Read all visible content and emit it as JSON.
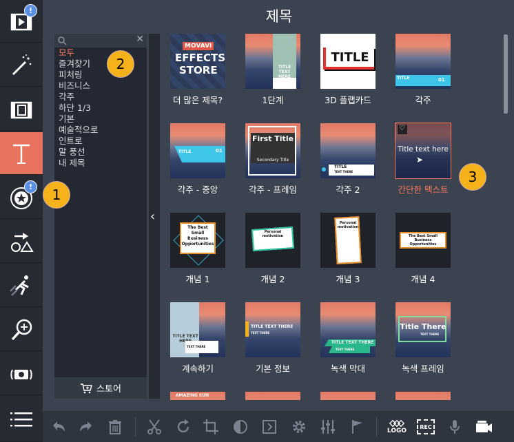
{
  "title": "제목",
  "sidebar": {
    "tools": [
      {
        "name": "media-import-icon",
        "badge": "!"
      },
      {
        "name": "magic-wand-icon"
      },
      {
        "name": "transitions-icon"
      },
      {
        "name": "titles-icon",
        "active": true
      },
      {
        "name": "stickers-icon",
        "badge": "!"
      },
      {
        "name": "callouts-icon"
      },
      {
        "name": "motion-icon"
      },
      {
        "name": "zoom-icon"
      },
      {
        "name": "camera-icon"
      },
      {
        "name": "more-menu-icon"
      }
    ]
  },
  "categories": {
    "items": [
      "모두",
      "즐겨찾기",
      "피처링",
      "비즈니스",
      "각주",
      "하단 1/3",
      "기본",
      "예술적으로",
      "인트로",
      "말 풍선",
      "내 제목"
    ],
    "selected": 0,
    "store_label": "스토어"
  },
  "thumbnails": [
    {
      "label": "더 많은 제목?"
    },
    {
      "label": "1단계"
    },
    {
      "label": "3D 플랩카드"
    },
    {
      "label": "각주"
    },
    {
      "label": "각주 - 중앙"
    },
    {
      "label": "각주 - 프레임"
    },
    {
      "label": "각주 2"
    },
    {
      "label": "간단한 텍스트"
    },
    {
      "label": "개념 1"
    },
    {
      "label": "개념 2"
    },
    {
      "label": "개념 3"
    },
    {
      "label": "개념 4"
    },
    {
      "label": "계속하기"
    },
    {
      "label": "기본 정보"
    },
    {
      "label": "녹색 막대"
    },
    {
      "label": "녹색 프레임"
    }
  ],
  "selected_thumbnail": 7,
  "thumb_text": {
    "effects_store": [
      "MOVAVI",
      "EFFECTS",
      "STORE"
    ],
    "title_upper": "TITLE",
    "title_text_here": "TITLE TEXT HERE",
    "text_there": "TEXT THERE",
    "title_text_there": "TITLE TEXT THERE",
    "number": "01",
    "first_title": "First Title",
    "secondary_title": "Secondary Title",
    "title_text_here_mixed": "Title text here",
    "small_business": "The Best Small Business Opportunities",
    "personal_motivation": "Personal motivation",
    "title_there": "Title There",
    "amazing": "AMAZING SUN"
  },
  "callouts": [
    "1",
    "2",
    "3"
  ],
  "toolbar": {
    "logo_label": "LOGO",
    "rec_label": "REC"
  }
}
